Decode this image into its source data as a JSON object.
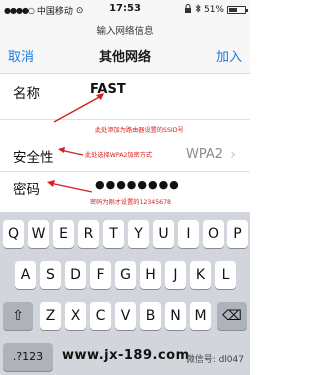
{
  "status_bar": {
    "carrier": "中国移动",
    "network": "⊙",
    "time": "17:53",
    "battery_percent": "51%",
    "icons": [
      "signal-icon",
      "wifi-icon",
      "lock-icon",
      "bluetooth-icon",
      "battery-icon"
    ]
  },
  "nav": {
    "subtitle": "输入网络信息",
    "cancel": "取消",
    "title": "其他网络",
    "join": "加入"
  },
  "form": {
    "name": {
      "label": "名称",
      "value": "FAST",
      "note": "此处添加为路由器设置的SSID号"
    },
    "security": {
      "label": "安全性",
      "value": "WPA2",
      "note": "此处选择WPA2加密方式"
    },
    "password": {
      "label": "密码",
      "value": "●●●●●●●●",
      "note": "密码为刚才设置的12345678"
    }
  },
  "keyboard": {
    "row1": [
      "Q",
      "W",
      "E",
      "R",
      "T",
      "Y",
      "U",
      "I",
      "O",
      "P"
    ],
    "row2": [
      "A",
      "S",
      "D",
      "F",
      "G",
      "H",
      "J",
      "K",
      "L"
    ],
    "row3": [
      "Z",
      "X",
      "C",
      "V",
      "B",
      "N",
      "M"
    ],
    "shift": "⇧",
    "delete": "⌫",
    "numbers": ".?123"
  },
  "watermark": {
    "site": "www.jx-189.com",
    "wechat": "微信号: dl047"
  },
  "colors": {
    "accent": "#1a7be2",
    "annotation": "#d42020",
    "keyboard_bg": "#d2d5db"
  }
}
